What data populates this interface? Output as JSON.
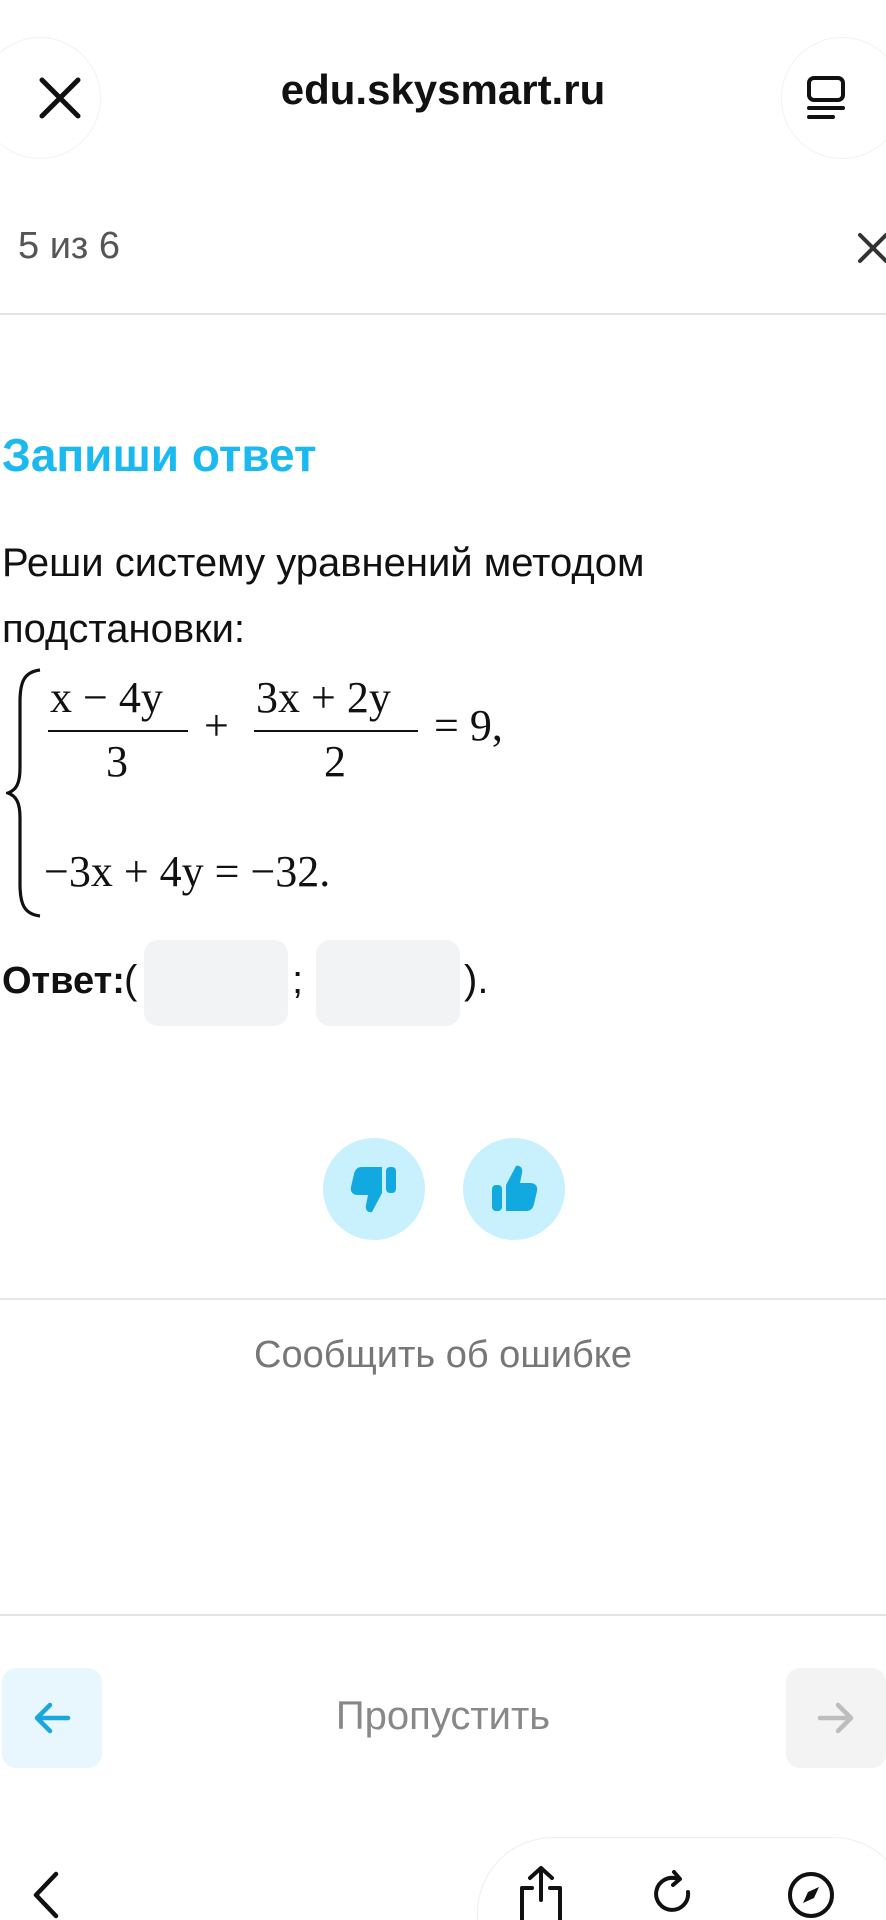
{
  "browser": {
    "url": "edu.skysmart.ru",
    "close_icon": "close-icon",
    "menu_icon": "reader-menu-icon"
  },
  "progress": {
    "text": "5 из 6"
  },
  "task": {
    "title": "Запиши ответ",
    "text": "Реши систему уравнений методом подстановки:",
    "equation1": {
      "frac1_num": "x − 4y",
      "frac1_den": "3",
      "plus": "+",
      "frac2_num": "3x + 2y",
      "frac2_den": "2",
      "rhs": "= 9,"
    },
    "equation2": "−3x + 4y = −32."
  },
  "answer": {
    "label": "Ответ:",
    "open": "(",
    "separator": ";",
    "close": ").",
    "value1": "",
    "value2": ""
  },
  "feedback": {
    "dislike_icon": "thumbs-down-icon",
    "like_icon": "thumbs-up-icon",
    "report": "Сообщить об ошибке"
  },
  "navigation": {
    "skip": "Пропустить"
  },
  "colors": {
    "accent": "#1ab9f0",
    "vote_bg": "#c9f0fd",
    "input_bg": "#f1f3f5",
    "muted_text": "#888888"
  }
}
